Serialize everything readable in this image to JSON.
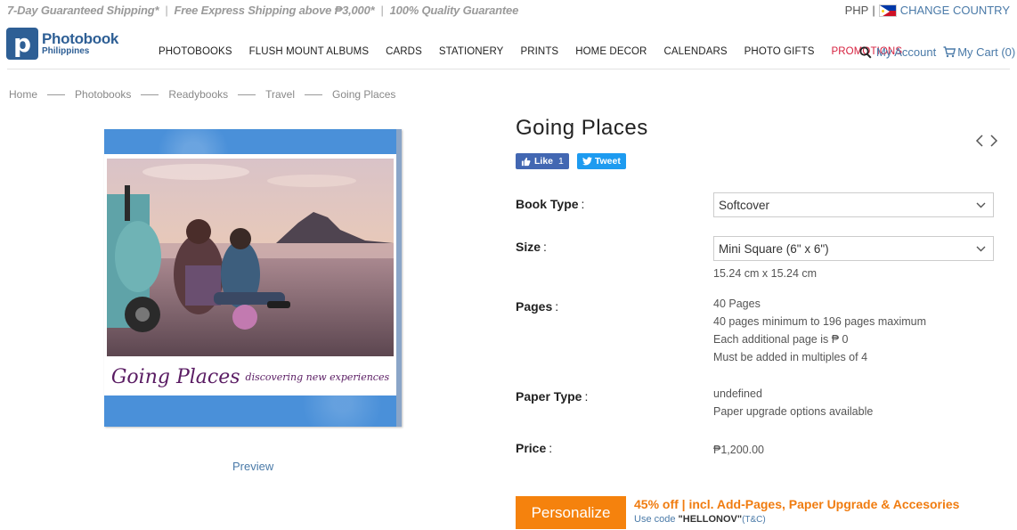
{
  "topbar": {
    "promos": [
      "7-Day Guaranteed Shipping*",
      "Free Express Shipping above ₱3,000*",
      "100% Quality Guarantee"
    ],
    "separator": "|",
    "currency": "PHP",
    "pipe": "|",
    "change_country": "CHANGE COUNTRY"
  },
  "logo": {
    "mark": "p",
    "title": "Photobook",
    "subtitle": "Philippines"
  },
  "nav": {
    "items": [
      "PHOTOBOOKS",
      "FLUSH MOUNT ALBUMS",
      "CARDS",
      "STATIONERY",
      "PRINTS",
      "HOME DECOR",
      "CALENDARS",
      "PHOTO GIFTS"
    ],
    "promotions": "PROMOTIONS"
  },
  "account": {
    "my_account": "My Account",
    "my_cart": "My Cart (0)"
  },
  "breadcrumb": [
    "Home",
    "Photobooks",
    "Readybooks",
    "Travel",
    "Going Places"
  ],
  "cover": {
    "title": "Going Places",
    "subtitle": "discovering new experiences"
  },
  "preview": "Preview",
  "product": {
    "title": "Going Places",
    "like_label": "Like",
    "like_count": "1",
    "tweet_label": "Tweet"
  },
  "fields": {
    "book_type": {
      "label": "Book Type",
      "colon": ":",
      "value": "Softcover"
    },
    "size": {
      "label": "Size",
      "colon": ":",
      "value": "Mini Square (6\" x 6\")",
      "dimensions": "15.24 cm x 15.24 cm"
    },
    "pages": {
      "label": "Pages",
      "colon": ":",
      "lines": [
        "40 Pages",
        "40 pages minimum to 196 pages maximum",
        "Each additional page is ₱ 0",
        "Must be added in multiples of 4"
      ]
    },
    "paper_type": {
      "label": "Paper Type",
      "colon": ":",
      "lines": [
        "undefined",
        "Paper upgrade options available"
      ]
    },
    "price": {
      "label": "Price",
      "colon": ":",
      "value": "₱1,200.00"
    }
  },
  "cta": {
    "button": "Personalize",
    "offer": "45% off | incl. Add-Pages, Paper Upgrade & Accesories",
    "code_prefix": "Use code ",
    "code": "\"HELLONOV\"",
    "tc": "(T&C)"
  },
  "colors": {
    "brand": "#2e5f95",
    "link": "#4a7aa8",
    "accent_orange": "#f5820d",
    "promo_red": "#d6213f",
    "cover_blue": "#4a90d9",
    "title_purple": "#5a1c63"
  }
}
